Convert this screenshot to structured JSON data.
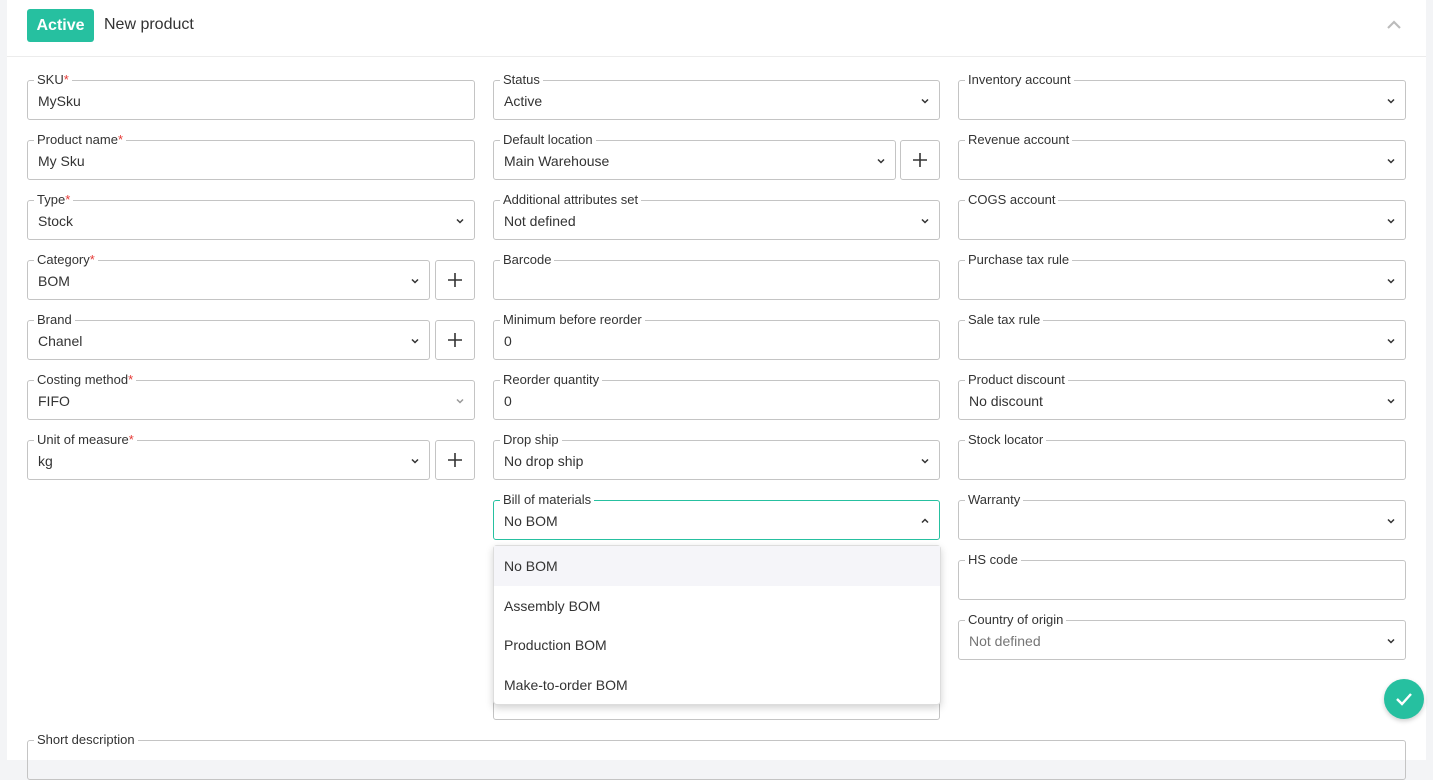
{
  "header": {
    "status_badge": "Active",
    "title": "New product"
  },
  "colors": {
    "accent": "#26c0a0",
    "required": "#e53935",
    "border": "#c4c4c4"
  },
  "form": {
    "sku": {
      "label": "SKU",
      "value": "MySku"
    },
    "product_name": {
      "label": "Product name",
      "value": "My Sku"
    },
    "type": {
      "label": "Type",
      "value": "Stock"
    },
    "category": {
      "label": "Category",
      "value": "BOM"
    },
    "brand": {
      "label": "Brand",
      "value": "Chanel"
    },
    "costing_method": {
      "label": "Costing method",
      "value": "FIFO"
    },
    "unit_of_measure": {
      "label": "Unit of measure",
      "value": "kg"
    },
    "status": {
      "label": "Status",
      "value": "Active"
    },
    "default_location": {
      "label": "Default location",
      "value": "Main Warehouse"
    },
    "additional_attributes_set": {
      "label": "Additional attributes set",
      "value": "Not defined"
    },
    "barcode": {
      "label": "Barcode",
      "value": ""
    },
    "minimum_before_reorder": {
      "label": "Minimum before reorder",
      "value": "0"
    },
    "reorder_quantity": {
      "label": "Reorder quantity",
      "value": "0"
    },
    "drop_ship": {
      "label": "Drop ship",
      "value": "No drop ship"
    },
    "bill_of_materials": {
      "label": "Bill of materials",
      "value": "No BOM",
      "options": [
        "No BOM",
        "Assembly BOM",
        "Production BOM",
        "Make-to-order BOM"
      ]
    },
    "inventory_account": {
      "label": "Inventory account",
      "value": ""
    },
    "revenue_account": {
      "label": "Revenue account",
      "value": ""
    },
    "cogs_account": {
      "label": "COGS account",
      "value": ""
    },
    "purchase_tax_rule": {
      "label": "Purchase tax rule",
      "value": ""
    },
    "sale_tax_rule": {
      "label": "Sale tax rule",
      "value": ""
    },
    "product_discount": {
      "label": "Product discount",
      "value": "No discount"
    },
    "stock_locator": {
      "label": "Stock locator",
      "value": ""
    },
    "warranty": {
      "label": "Warranty",
      "value": ""
    },
    "hs_code": {
      "label": "HS code",
      "value": ""
    },
    "country_of_origin": {
      "label": "Country of origin",
      "value": "Not defined"
    },
    "short_description": {
      "label": "Short description"
    }
  },
  "icons": {
    "collapse": "chevron-up-icon",
    "dropdown": "chevron-down-icon",
    "add": "plus-icon",
    "save": "check-icon"
  }
}
